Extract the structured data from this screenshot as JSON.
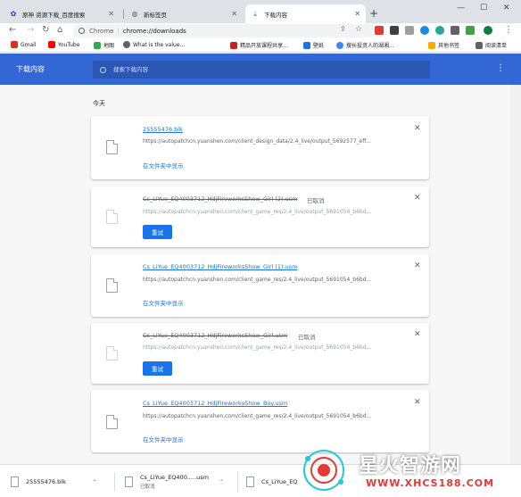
{
  "tabs": [
    {
      "title": "原神 资源下载_百度搜索",
      "icon": "baidu-icon",
      "active": false
    },
    {
      "title": "新标签页",
      "icon": "globe-icon",
      "active": false
    },
    {
      "title": "下载内容",
      "icon": "download-icon",
      "active": true
    }
  ],
  "omnibox": {
    "scheme": "Chrome",
    "sep": "|",
    "url": "chrome://downloads"
  },
  "bookmarks": [
    {
      "label": "Gmail",
      "icon": "gmail-icon",
      "color": "#d93025"
    },
    {
      "label": "YouTube",
      "icon": "youtube-icon",
      "color": "#ff0000"
    },
    {
      "label": "地图",
      "icon": "maps-icon",
      "color": "#34a853"
    },
    {
      "label": "What is the value...",
      "icon": "globe-icon",
      "color": "#5f6368"
    },
    {
      "label": "精品开放课程共享...",
      "icon": "course-icon",
      "color": "#c5221f"
    },
    {
      "label": "壁纸",
      "icon": "wallpaper-icon",
      "color": "#1a73e8"
    },
    {
      "label": "搜长投资人的湖湘...",
      "icon": "paw-icon",
      "color": "#4285f4"
    },
    {
      "label": "其他书签",
      "icon": "folder-icon",
      "color": "#f9ab00"
    },
    {
      "label": "阅读清单",
      "icon": "reading-list-icon",
      "color": "#5f6368"
    }
  ],
  "downloads_page": {
    "title": "下载内容",
    "search_placeholder": "搜索下载内容",
    "date_label": "今天",
    "items": [
      {
        "name": "25555476.blk",
        "url": "https://autopatchcn.yuanshen.com/client_design_data/2.4_live/output_5692577_eff...",
        "action": "在文件夹中显示",
        "status": "",
        "cancelled": false
      },
      {
        "name": "Cs_LiYue_EQ4003712_HdjFireworksShow_Girl (2).usm",
        "url": "https://autopatchcn.yuanshen.com/client_game_res/2.4_live/output_5691054_b6bd...",
        "action": "重试",
        "status": "已取消",
        "cancelled": true
      },
      {
        "name": "Cs_LiYue_EQ4003712_HdjFireworksShow_Girl (1).usm",
        "url": "https://autopatchcn.yuanshen.com/client_game_res/2.4_live/output_5691054_b6bd...",
        "action": "在文件夹中显示",
        "status": "",
        "cancelled": false
      },
      {
        "name": "Cs_LiYue_EQ4003712_HdjFireworksShow_Girl.usm",
        "url": "https://autopatchcn.yuanshen.com/client_game_res/2.4_live/output_5691054_b6bd...",
        "action": "重试",
        "status": "已取消",
        "cancelled": true
      },
      {
        "name": "Cs_LiYue_EQ4003712_HdjFireworksShow_Boy.usm",
        "url": "https://autopatchcn.yuanshen.com/client_game_res/2.4_live/output_5691054_b6bd...",
        "action": "在文件夹中显示",
        "status": "",
        "cancelled": false
      }
    ]
  },
  "shelf": [
    {
      "name": "25555476.blk",
      "sub": ""
    },
    {
      "name": "Cs_LiYue_EQ400.....usm",
      "sub": "已取消"
    },
    {
      "name": "Cs_LiYue_EQ",
      "sub": ""
    }
  ],
  "watermark": {
    "title": "星火智游网",
    "url": "WWW.XHCS188.COM"
  },
  "colors": {
    "header": "#3367d6",
    "link": "#1a73e8",
    "tabstrip": "#dee1e6"
  }
}
